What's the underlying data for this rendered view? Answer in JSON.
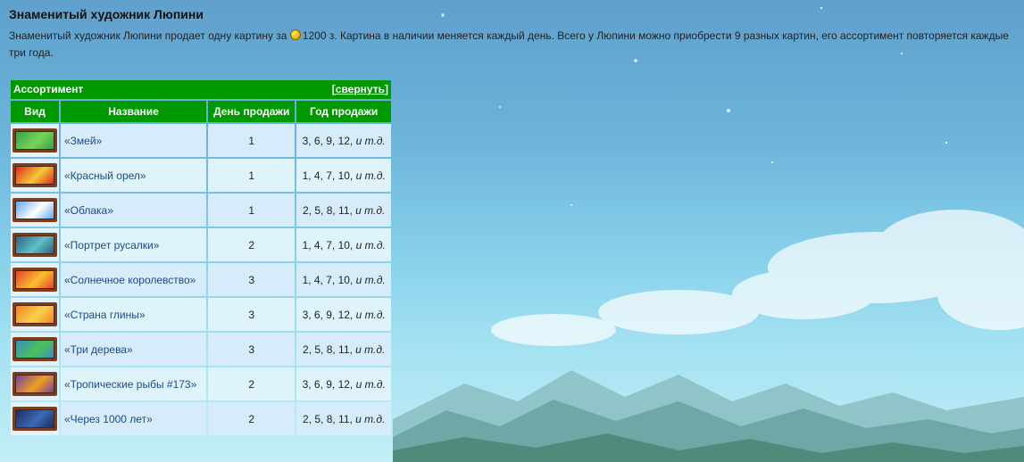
{
  "section": {
    "title": "Знаменитый художник Люпини",
    "description_part1": "Знаменитый художник Люпини продает одну картину за ",
    "price": "1200 з",
    "description_part2": ". Картина в наличии меняется каждый день. Всего у Люпини можно приобрести 9 разных картин, его ассортимент повторяется каждые три года."
  },
  "table": {
    "title": "Ассортимент",
    "toggle_label": "свернуть",
    "toggle_open": "[",
    "toggle_close": "]",
    "headers": [
      "Вид",
      "Название",
      "День продажи",
      "Год продажи"
    ],
    "etc_label": "и т.д.",
    "rows": [
      {
        "icon": "snakes-painting-icon",
        "name": "«Змей»",
        "day": "1",
        "years": "3, 6, 9, 12, ",
        "colors": [
          "#2ea048",
          "#7ad35a"
        ]
      },
      {
        "icon": "red-eagle-painting-icon",
        "name": "«Красный орел»",
        "day": "1",
        "years": "1, 4, 7, 10, ",
        "colors": [
          "#e0201a",
          "#f3c838"
        ]
      },
      {
        "icon": "clouds-painting-icon",
        "name": "«Облака»",
        "day": "1",
        "years": "2, 5, 8, 11, ",
        "colors": [
          "#5aa0f0",
          "#ffffff"
        ]
      },
      {
        "icon": "mermaid-portrait-painting-icon",
        "name": "«Портрет русалки»",
        "day": "2",
        "years": "1, 4, 7, 10, ",
        "colors": [
          "#2a5a7a",
          "#5dc0c8"
        ]
      },
      {
        "icon": "sun-kingdom-painting-icon",
        "name": "«Солнечное королевство»",
        "day": "3",
        "years": "1, 4, 7, 10, ",
        "colors": [
          "#e83a2a",
          "#f8c030"
        ]
      },
      {
        "icon": "clay-land-painting-icon",
        "name": "«Страна глины»",
        "day": "3",
        "years": "3, 6, 9, 12, ",
        "colors": [
          "#f08020",
          "#f8d048"
        ]
      },
      {
        "icon": "three-trees-painting-icon",
        "name": "«Три дерева»",
        "day": "3",
        "years": "2, 5, 8, 11, ",
        "colors": [
          "#3a8ac8",
          "#4cc05a"
        ]
      },
      {
        "icon": "tropical-fish-painting-icon",
        "name": "«Тропические рыбы #173»",
        "day": "2",
        "years": "3, 6, 9, 12, ",
        "colors": [
          "#6a3aa8",
          "#f0a020"
        ]
      },
      {
        "icon": "in-1000-years-painting-icon",
        "name": "«Через 1000 лет»",
        "day": "2",
        "years": "2, 5, 8, 11, ",
        "colors": [
          "#1a2a50",
          "#3a6ab8"
        ]
      }
    ]
  }
}
